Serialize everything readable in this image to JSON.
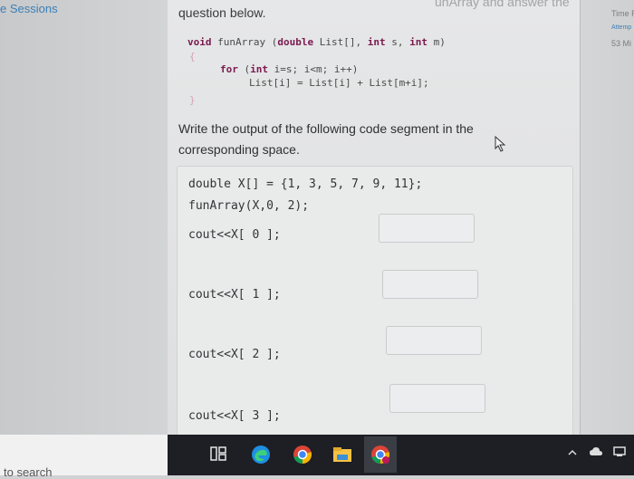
{
  "sidebar": {
    "title": "e Sessions"
  },
  "right_panel": {
    "time_label": "Time R",
    "attempt_label": "Attemp",
    "minutes": "53 Mi"
  },
  "question": {
    "header_faded": "unArray and answer the",
    "intro": "question below.",
    "code": {
      "signature_kw": "void",
      "signature_name": " funArray ",
      "signature_paren_open": "(",
      "param1_type": "double",
      "param1_name": " List[], ",
      "param2_type": "int",
      "param2_name": " s, ",
      "param3_type": "int",
      "param3_name": " m)",
      "open_brace": "{",
      "for_kw": "for",
      "for_paren": " (",
      "for_int": "int",
      "for_rest": " i=s; i<m; i++)",
      "body": "List[i] = List[i] + List[m+i];",
      "close_brace": "}"
    },
    "instruction": "Write the output of the following code segment in the corresponding space.",
    "program": {
      "decl": "double X[] = {1, 3, 5, 7, 9, 11};",
      "call": "funArray(X,0, 2);",
      "outputs": [
        "cout<<X[ 0 ];",
        "cout<<X[ 1 ];",
        "cout<<X[ 2 ];",
        "cout<<X[ 3 ];"
      ]
    }
  },
  "taskbar": {
    "search_label": "to search",
    "icons": [
      "task-view-icon",
      "edge-icon",
      "chrome-icon",
      "file-explorer-icon",
      "chrome-profile-icon"
    ],
    "tray": [
      "chevron-up-icon",
      "cloud-icon",
      "network-icon"
    ]
  },
  "colors": {
    "keyword": "#7a1a50",
    "link": "#3c7fb6",
    "taskbar": "#1d1f24"
  }
}
